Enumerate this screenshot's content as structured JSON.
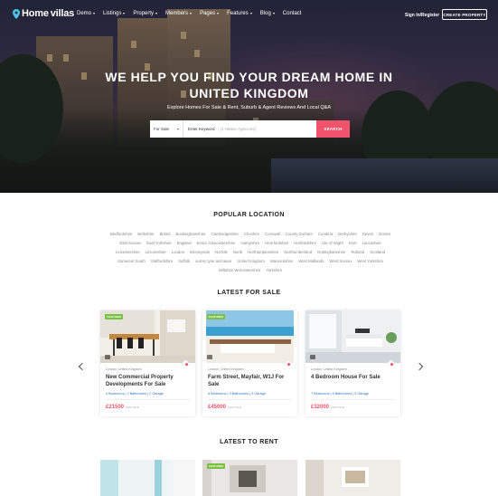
{
  "brand": {
    "name_part1": "Home",
    "name_part2": "villas"
  },
  "nav": {
    "items": [
      {
        "label": "Demo",
        "dropdown": true
      },
      {
        "label": "Listings",
        "dropdown": true
      },
      {
        "label": "Property",
        "dropdown": true
      },
      {
        "label": "Members",
        "dropdown": true
      },
      {
        "label": "Pages",
        "dropdown": true
      },
      {
        "label": "Features",
        "dropdown": true
      },
      {
        "label": "Blog",
        "dropdown": true
      },
      {
        "label": "Contact",
        "dropdown": false
      }
    ],
    "signin": "Sign In/Register",
    "create": "CREATE PROPERTY"
  },
  "hero": {
    "title_line1": "WE HELP YOU FIND YOUR DREAM HOME IN",
    "title_line2": "UNITED KINGDOM",
    "subtitle": "Explore Homes For Sale & Rent, Suburb & Agent Reviews And Local Q&A"
  },
  "search": {
    "type_value": "For Sale",
    "keyword_label": "Enter Keyword",
    "keyword_placeholder": "(4 Hatton Agencies)",
    "button": "SEARCH"
  },
  "popular": {
    "heading": "POPULAR LOCATION",
    "locations": [
      "Bedfordshire",
      "Berkshire",
      "Bristol",
      "Buckinghamshire",
      "Cambridgeshire",
      "Cheshire",
      "Cornwall",
      "County Durham",
      "Cumbria",
      "Derbyshire",
      "Devon",
      "Dorset",
      "East Sussex",
      "East Yorkshire",
      "England",
      "Essex Gloucestershire",
      "Hampshire",
      "Herefordshire",
      "Hertfordshire",
      "Isle of Wight",
      "Kent",
      "Lancashire",
      "Leicestershire",
      "Lincolnshire",
      "London",
      "Merseyside",
      "Norfolk",
      "North",
      "Northamptonshire",
      "Northumberland",
      "Nottinghamshire",
      "Rutland",
      "Scotland",
      "Somerset South",
      "Staffordshire",
      "Suffolk",
      "surrey tyne and wear",
      "United Kingdom",
      "Warwickshire",
      "West Midlands",
      "West Sussex",
      "West Yorkshire",
      "Wiltshire Worcestershire",
      "Yorkshire"
    ]
  },
  "sale": {
    "heading": "LATEST FOR SALE",
    "cards": [
      {
        "badge": "FEATURED",
        "location": "London, United Kingdom",
        "title": "New Commercial Property Developments For Sale",
        "features": "4 Bedrooms | 2 Bathrooms | 2 Garage",
        "price": "£21500",
        "price_note": "FOR SALE"
      },
      {
        "badge": "FEATURED",
        "location": "London, United Kingdom",
        "title": "Farm Street, Mayfair, W1J For Sale",
        "features": "6 Bedrooms | 3 Bathrooms | 3 Garage",
        "price": "£45000",
        "price_note": "FOR SALE"
      },
      {
        "badge": "",
        "location": "London, United Kingdom",
        "title": "4 Bedroom House For Sale",
        "features": "7 Bedrooms | 6 Bathrooms | 5 Garage",
        "price": "£32000",
        "price_note": "FOR SALE"
      }
    ]
  },
  "rent": {
    "heading": "LATEST TO RENT",
    "cards": [
      {
        "badge": ""
      },
      {
        "badge": "FEATURED"
      },
      {
        "badge": ""
      }
    ]
  },
  "colors": {
    "accent": "#f0536b",
    "link": "#2d73c8",
    "badge": "#7ac143"
  }
}
